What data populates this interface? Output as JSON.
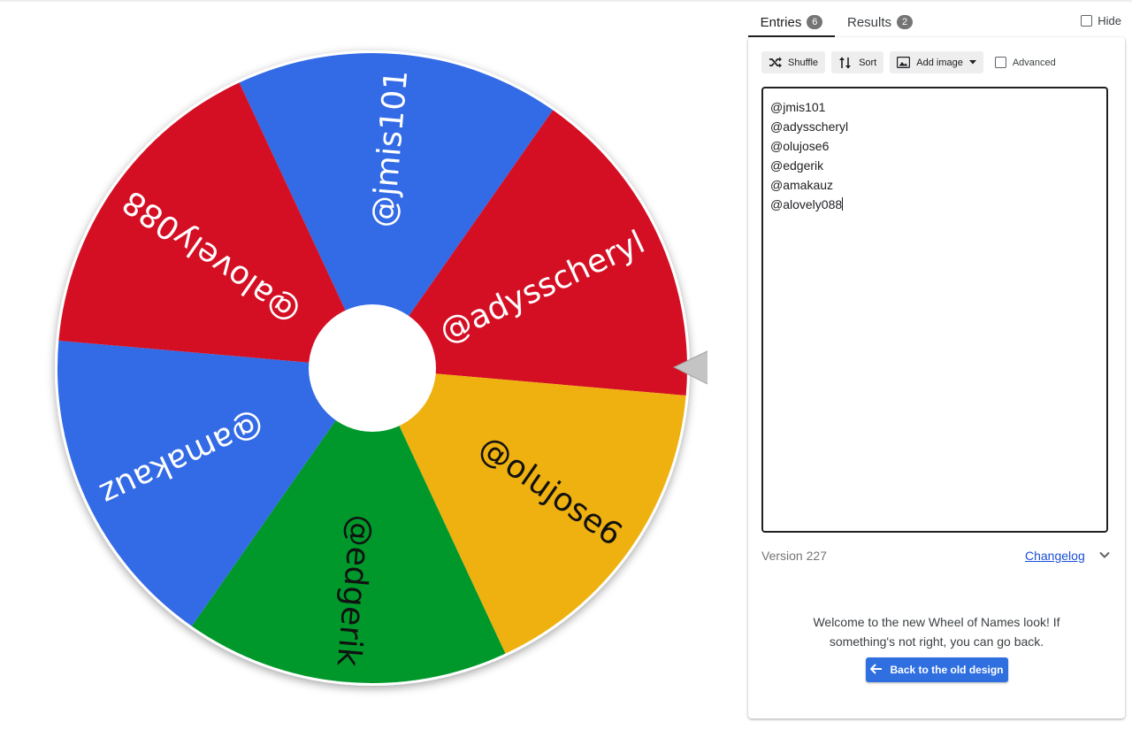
{
  "colors": {
    "accent": "#2f6fe0",
    "link": "#1a4fd6",
    "wheel_red": "#d40f24",
    "wheel_blue": "#336ae5",
    "wheel_yellow": "#efb10f",
    "wheel_green": "#00982a"
  },
  "wheel": {
    "segments": [
      {
        "label": "@jmis101",
        "color": "#336ae5"
      },
      {
        "label": "@adysscheryl",
        "color": "#d40f24"
      },
      {
        "label": "@olujose6",
        "color": "#efb10f"
      },
      {
        "label": "@edgerik",
        "color": "#00982a"
      },
      {
        "label": "@amakauz",
        "color": "#336ae5"
      },
      {
        "label": "@alovely088",
        "color": "#d40f24"
      }
    ],
    "pointer_icon": "triangle-pointer-icon"
  },
  "tabs": {
    "entries_label": "Entries",
    "entries_count": "6",
    "results_label": "Results",
    "results_count": "2",
    "hide_label": "Hide"
  },
  "toolbar": {
    "shuffle_label": "Shuffle",
    "sort_label": "Sort",
    "add_image_label": "Add image",
    "advanced_label": "Advanced"
  },
  "entries": [
    "@jmis101",
    "@adysscheryl",
    "@olujose6",
    "@edgerik",
    "@amakauz",
    "@alovely088"
  ],
  "footer": {
    "version": "Version 227",
    "changelog": "Changelog"
  },
  "welcome": {
    "message": "Welcome to the new Wheel of Names look! If something's not right, you can go back.",
    "back_button": "Back to the old design"
  }
}
